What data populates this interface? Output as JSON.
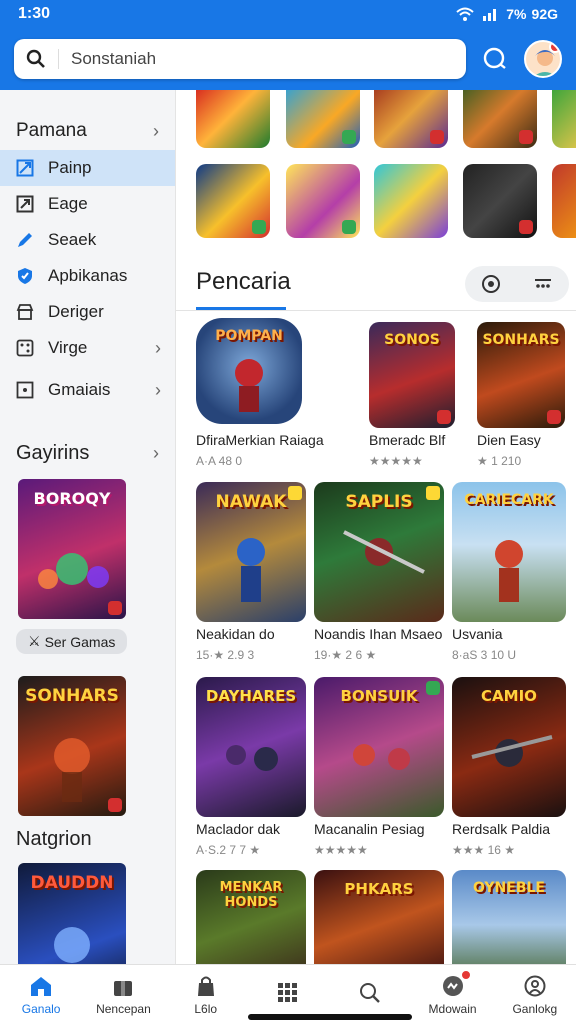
{
  "status": {
    "time": "1:30",
    "signal": "⫨ ® ·ıı",
    "battery": "7%  92G"
  },
  "search": {
    "value": "Sonstaniah"
  },
  "sidebar": {
    "heading": "Pamana",
    "items": [
      {
        "label": "Painp",
        "icon": "grid-square-icon"
      },
      {
        "label": "Eage",
        "icon": "expand-box-icon"
      },
      {
        "label": "Seaek",
        "icon": "pencil-icon"
      },
      {
        "label": "Apbikanas",
        "icon": "shield-icon"
      },
      {
        "label": "Deriger",
        "icon": "store-icon"
      },
      {
        "label": "Virge",
        "icon": "dice-icon"
      },
      {
        "label": "Gmaiais",
        "icon": "dice-box-icon"
      }
    ],
    "section1": "Gayirins",
    "card1_title": "BOROQY",
    "chip_label": "Ser Gamas",
    "card2_title": "SONHARS",
    "section2": "Natgrion",
    "card3_title": "DAUDDN"
  },
  "main": {
    "section_title": "Pencaria",
    "games": [
      {
        "name": "DfiraMerkian Raiaga",
        "rating": "A·A 48 0",
        "art": "POMPAN"
      },
      {
        "name": "Bmeradc Blf",
        "rating": "★★★★★",
        "art": "SONOS"
      },
      {
        "name": "Dien Easy",
        "rating": "★ 1 210",
        "art": "SONHARS"
      },
      {
        "name": "Neakidan do",
        "rating": "15·★ 2.9 3",
        "art": "NAWAK"
      },
      {
        "name": "Noandis Ihan Msaeo",
        "rating": "19·★ 2 6 ★",
        "art": "SAPLIS"
      },
      {
        "name": "Usvania",
        "rating": "8·аS 3 10 U",
        "art": "CARIECARK"
      },
      {
        "name": "Maclador dak",
        "rating": "A·S.2 7 7 ★",
        "art": "DAYHARES"
      },
      {
        "name": "Macanalin Pesiag",
        "rating": "★★★★★",
        "art": "BONSUIK"
      },
      {
        "name": "Rerdsalk Paldia",
        "rating": "★★★ 16 ★",
        "art": "CAMIO"
      },
      {
        "name": "",
        "rating": "",
        "art": "MENKAR HONDS"
      },
      {
        "name": "",
        "rating": "",
        "art": "PHKARS"
      },
      {
        "name": "",
        "rating": "",
        "art": "OYNEBLE"
      }
    ]
  },
  "nav": [
    {
      "label": "Ganalo",
      "icon": "home-icon"
    },
    {
      "label": "Nencepan",
      "icon": "gift-icon"
    },
    {
      "label": "L6lo",
      "icon": "bag-icon"
    },
    {
      "label": "",
      "icon": "apps-grid-icon"
    },
    {
      "label": "",
      "icon": "search-icon"
    },
    {
      "label": "Mdowain",
      "icon": "controller-icon"
    },
    {
      "label": "Ganlokg",
      "icon": "user-circle-icon"
    }
  ],
  "colors": {
    "accent": "#1877e6",
    "active_row": "#cfe3f8",
    "sidebar_bg": "#f4f5f7"
  }
}
